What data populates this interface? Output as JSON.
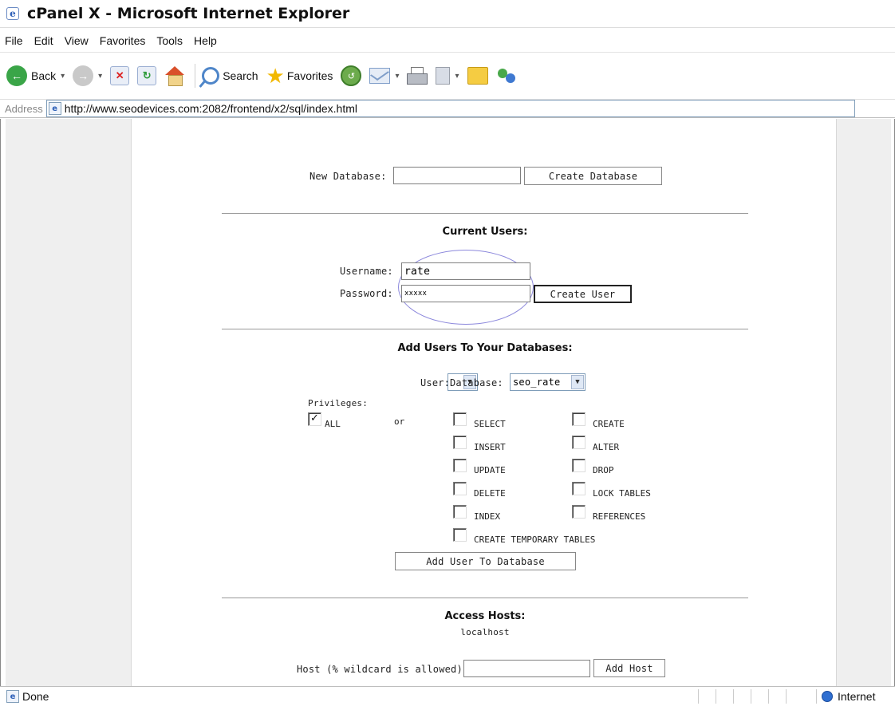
{
  "window": {
    "title": "cPanel X - Microsoft Internet Explorer"
  },
  "menu": [
    "File",
    "Edit",
    "View",
    "Favorites",
    "Tools",
    "Help"
  ],
  "toolbar": {
    "back_label": "Back",
    "search_label": "Search",
    "favorites_label": "Favorites"
  },
  "address": {
    "label": "Address",
    "url": "http://www.seodevices.com:2082/frontend/x2/sql/index.html"
  },
  "new_database": {
    "label": "New Database:",
    "value": "",
    "button": "Create Database"
  },
  "current_users": {
    "heading": "Current Users:",
    "username_label": "Username:",
    "username_value": "rate",
    "password_label": "Password:",
    "password_value": "xxxxx",
    "button": "Create User"
  },
  "add_users": {
    "heading": "Add Users To Your Databases:",
    "user_label": "User:",
    "user_value": "",
    "database_label": "Database:",
    "database_value": "seo_rate",
    "privileges_label": "Privileges:",
    "all_label": "ALL",
    "all_checked": true,
    "or_label": "or",
    "privileges_col1": [
      "SELECT",
      "INSERT",
      "UPDATE",
      "DELETE",
      "INDEX",
      "CREATE TEMPORARY TABLES"
    ],
    "privileges_col2": [
      "CREATE",
      "ALTER",
      "DROP",
      "LOCK TABLES",
      "REFERENCES"
    ],
    "button": "Add User To Database"
  },
  "access_hosts": {
    "heading": "Access Hosts:",
    "host_listed": "localhost",
    "host_label": "Host (% wildcard is allowed):",
    "host_value": "",
    "button": "Add Host"
  },
  "status": {
    "left_text": "Done",
    "zone_text": "Internet"
  }
}
